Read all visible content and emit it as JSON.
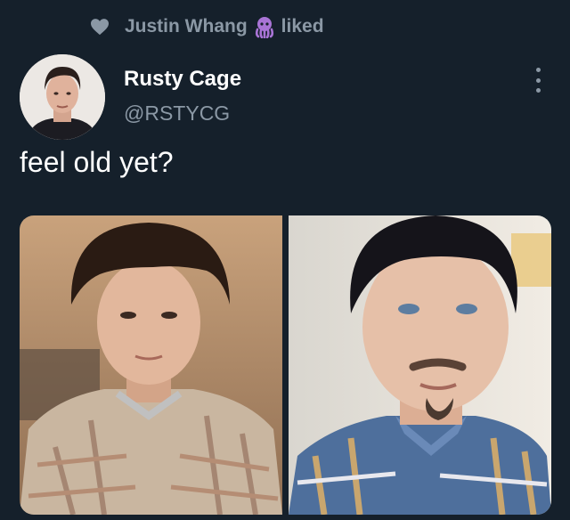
{
  "social_context": {
    "user_name": "Justin Whang",
    "action": "liked",
    "icon": "heart-icon",
    "emoji_icon": "octopus-icon"
  },
  "author": {
    "name": "Rusty Cage",
    "handle": "@RSTYCG",
    "avatar_icon": "avatar-photo"
  },
  "more_icon": "more-options-icon",
  "tweet": {
    "text": "feel old yet?"
  },
  "media": {
    "count": 2,
    "photos": [
      {
        "subject": "young man with bowl haircut in plaid shirt"
      },
      {
        "subject": "man with bowl haircut and goatee in plaid shirt"
      }
    ]
  },
  "colors": {
    "background": "#15202b",
    "secondary_text": "#8b98a5",
    "primary_text": "#ffffff",
    "octopus": "#a974d6"
  }
}
